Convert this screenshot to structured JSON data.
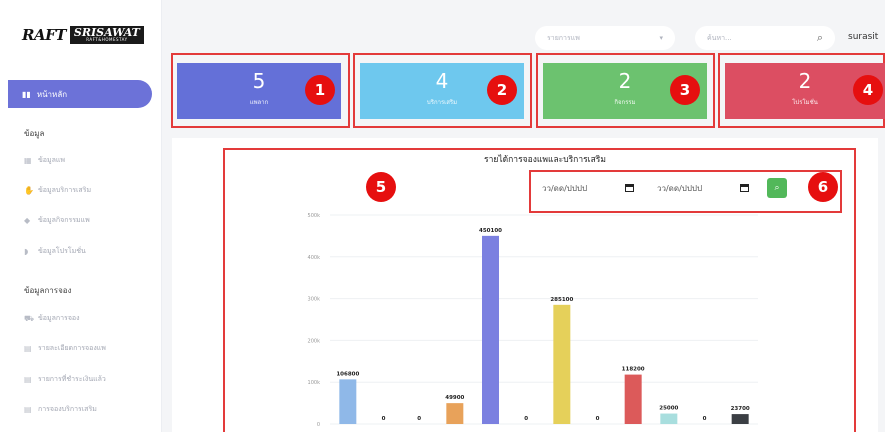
{
  "logo": {
    "raft": "RAFT",
    "brand": "SRISAWAT",
    "sub": "RAFT&HOMESTAY"
  },
  "sidebar": {
    "active_item": {
      "icon": "bar-chart-icon",
      "label": "หน้าหลัก"
    },
    "sections": [
      {
        "label": "ข้อมูล",
        "items": [
          {
            "icon": "table-icon",
            "label": "ข้อมูลแพ"
          },
          {
            "icon": "handshake-icon",
            "label": "ข้อมูลบริการเสริม"
          },
          {
            "icon": "tag-icon",
            "label": "ข้อมูลกิจกรรมแพ"
          },
          {
            "icon": "promo-tag-icon",
            "label": "ข้อมูลโปรโมชั่น"
          }
        ]
      },
      {
        "label": "ข้อมูลการจอง",
        "items": [
          {
            "icon": "cart-icon",
            "label": "ข้อมูลการจอง"
          },
          {
            "icon": "list-icon",
            "label": "รายละเอียดการจองแพ"
          },
          {
            "icon": "list-icon",
            "label": "รายการที่ชำระเงินแล้ว"
          },
          {
            "icon": "list-icon",
            "label": "การจองบริการเสริม"
          }
        ]
      }
    ]
  },
  "topbar": {
    "select_placeholder": "รายการแพ",
    "search_placeholder": "ค้นหา...",
    "user": "surasit"
  },
  "cards": [
    {
      "value": "5",
      "label": "แพลาก",
      "color": "#6470d8",
      "badge": "1"
    },
    {
      "value": "4",
      "label": "บริการเสริม",
      "color": "#6ec8ee",
      "badge": "2"
    },
    {
      "value": "2",
      "label": "กิจกรรม",
      "color": "#6cc26f",
      "badge": "3"
    },
    {
      "value": "2",
      "label": "โปรโมชั่น",
      "color": "#dc4e62",
      "badge": "4"
    }
  ],
  "chart_panel": {
    "badge": "5",
    "date_from": "วว/ดด/ปปปป",
    "date_to": "วว/ดด/ปปปป",
    "date_badge": "6"
  },
  "chart_data": {
    "type": "bar",
    "title": "รายได้การจองแพและบริการเสริม",
    "ylim": [
      0,
      500000
    ],
    "y_ticks": [
      "0",
      "100k",
      "200k",
      "300k",
      "400k",
      "500k"
    ],
    "grid": true,
    "series": [
      {
        "values": [
          106800,
          0,
          0,
          49900,
          450100,
          0,
          285100,
          0,
          118200,
          25000,
          0,
          23700
        ],
        "labels": [
          "106800",
          "0",
          "0",
          "49900",
          "450100",
          "0",
          "285100",
          "0",
          "118200",
          "25000",
          "0",
          "23700"
        ],
        "colors": [
          "#8fb8e8",
          "#8fb8e8",
          "#8fb8e8",
          "#e8a25a",
          "#7b80e0",
          "#7b80e0",
          "#e5d05a",
          "#e5d05a",
          "#dc5a5a",
          "#a8dede",
          "#a8dede",
          "#3b3f44"
        ]
      }
    ]
  }
}
